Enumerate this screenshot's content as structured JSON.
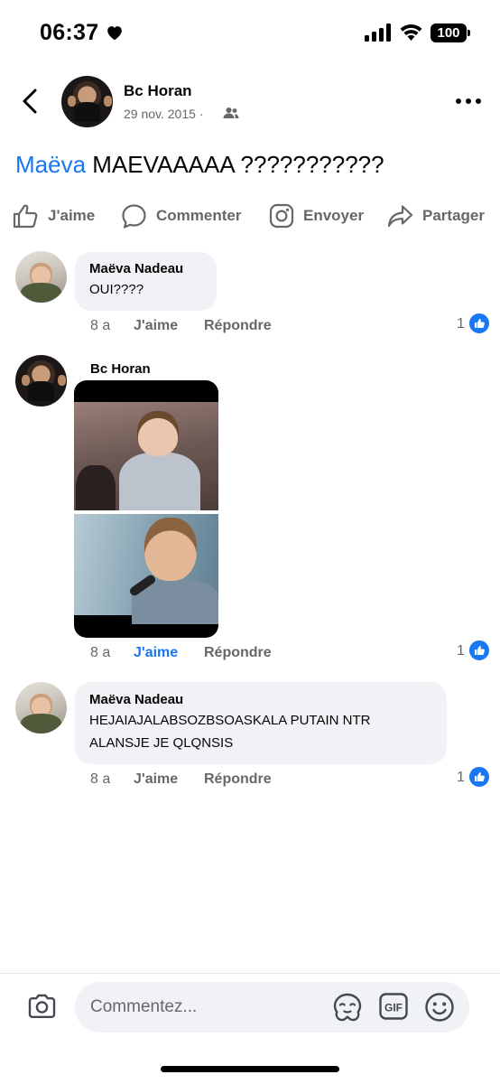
{
  "status_bar": {
    "time": "06:37",
    "battery": "100",
    "icons": [
      "heart-icon",
      "cellular-signal-icon",
      "wifi-icon",
      "battery-icon"
    ]
  },
  "post": {
    "author": "Bc Horan",
    "date": "29 nov. 2015 ·",
    "audience_icon": "friends-audience-icon",
    "mention": "Maëva",
    "text": " MAEVAAAAA  ???????????"
  },
  "actions": {
    "like": "J'aime",
    "comment": "Commenter",
    "send": "Envoyer",
    "share": "Partager"
  },
  "comments": [
    {
      "author": "Maëva Nadeau",
      "text": "OUI????",
      "age": "8 a",
      "like_label": "J'aime",
      "reply_label": "Répondre",
      "reactions": "1",
      "liked": false
    },
    {
      "author": "Bc Horan",
      "text": "",
      "attachment": "photo",
      "age": "8 a",
      "like_label": "J'aime",
      "reply_label": "Répondre",
      "reactions": "1",
      "liked": true
    },
    {
      "author": "Maëva Nadeau",
      "text_lines": [
        "HEJAIAJALABSOZBSOASKALA PUTAIN NTR",
        "ALANSJE JE QLQNSIS"
      ],
      "age": "8 a",
      "like_label": "J'aime",
      "reply_label": "Répondre",
      "reactions": "1",
      "liked": false
    }
  ],
  "composer": {
    "placeholder": "Commentez...",
    "icons": [
      "camera-icon",
      "avatar-sticker-icon",
      "gif-icon",
      "emoji-icon"
    ]
  },
  "colors": {
    "accent": "#1877f2",
    "secondary_text": "#65676b",
    "bubble": "#f0f2f5"
  }
}
